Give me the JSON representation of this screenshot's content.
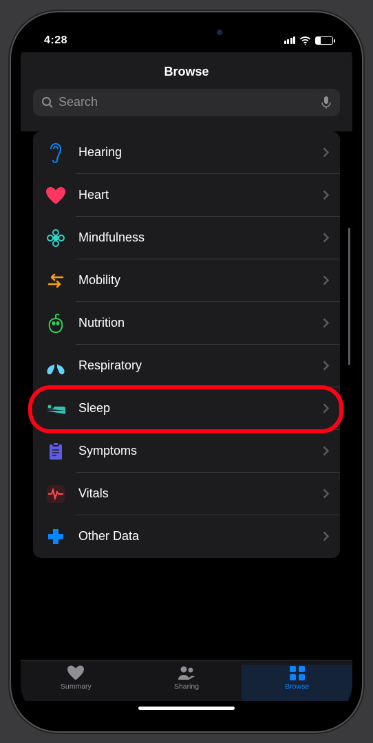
{
  "status": {
    "time": "4:28"
  },
  "header": {
    "title": "Browse"
  },
  "search": {
    "placeholder": "Search"
  },
  "categories": [
    {
      "id": "hearing",
      "label": "Hearing",
      "icon": "ear",
      "color": "#0a84ff"
    },
    {
      "id": "heart",
      "label": "Heart",
      "icon": "heart",
      "color": "#ff375f"
    },
    {
      "id": "mindfulness",
      "label": "Mindfulness",
      "icon": "flower",
      "color": "#66d4cf"
    },
    {
      "id": "mobility",
      "label": "Mobility",
      "icon": "arrows",
      "color": "#ff9f0a"
    },
    {
      "id": "nutrition",
      "label": "Nutrition",
      "icon": "apple",
      "color": "#30d158"
    },
    {
      "id": "respiratory",
      "label": "Respiratory",
      "icon": "lungs",
      "color": "#64d2ff"
    },
    {
      "id": "sleep",
      "label": "Sleep",
      "icon": "bed",
      "color": "#2fc2b5",
      "highlighted": true
    },
    {
      "id": "symptoms",
      "label": "Symptoms",
      "icon": "clipboard",
      "color": "#5e5ce6"
    },
    {
      "id": "vitals",
      "label": "Vitals",
      "icon": "ecg",
      "color": "#ff4d4d"
    },
    {
      "id": "other",
      "label": "Other Data",
      "icon": "plus",
      "color": "#0a84ff"
    }
  ],
  "tabs": [
    {
      "id": "summary",
      "label": "Summary",
      "active": false
    },
    {
      "id": "sharing",
      "label": "Sharing",
      "active": false
    },
    {
      "id": "browse",
      "label": "Browse",
      "active": true
    }
  ]
}
